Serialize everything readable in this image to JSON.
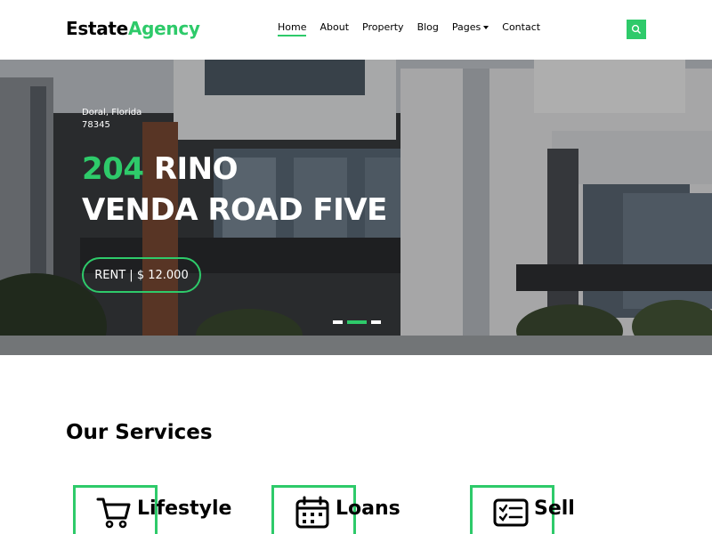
{
  "brand": {
    "part1": "Estate",
    "part2": "Agency"
  },
  "nav": {
    "home": "Home",
    "about": "About",
    "property": "Property",
    "blog": "Blog",
    "pages": "Pages",
    "contact": "Contact"
  },
  "hero": {
    "location_line1": "Doral, Florida",
    "location_line2": "78345",
    "title_accent": "204",
    "title_rest1": " RINO",
    "title_line2": "VENDA ROAD FIVE",
    "rent_label": "RENT | $ 12.000",
    "active_slide": 2,
    "slide_count": 3
  },
  "services": {
    "heading": "Our Services",
    "items": [
      {
        "label": "Lifestyle",
        "icon": "cart-icon"
      },
      {
        "label": "Loans",
        "icon": "calendar-icon"
      },
      {
        "label": "Sell",
        "icon": "checklist-icon"
      }
    ]
  },
  "colors": {
    "accent": "#2eca6a",
    "text": "#000000"
  }
}
